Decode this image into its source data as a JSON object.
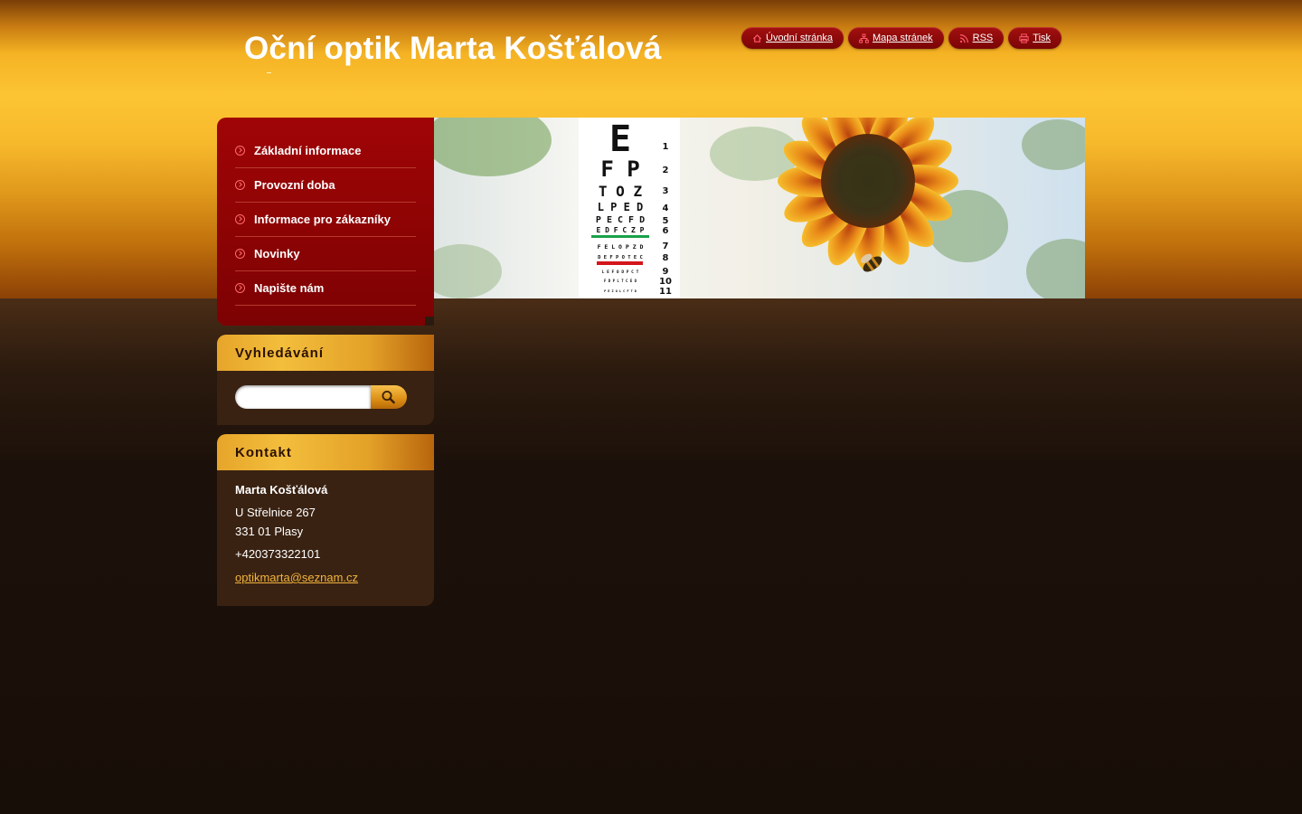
{
  "header": {
    "site_title": "Oční optik Marta Košťálová"
  },
  "top_links": [
    {
      "label": "Úvodní stránka",
      "icon": "home-icon"
    },
    {
      "label": "Mapa stránek",
      "icon": "sitemap-icon"
    },
    {
      "label": "RSS",
      "icon": "rss-icon"
    },
    {
      "label": "Tisk",
      "icon": "print-icon"
    }
  ],
  "nav": {
    "items": [
      {
        "label": "Základní informace"
      },
      {
        "label": "Provozní doba"
      },
      {
        "label": "Informace pro zákazníky"
      },
      {
        "label": "Novinky"
      },
      {
        "label": "Napište nám"
      }
    ]
  },
  "banner": {
    "chart_letters": [
      "E",
      "F P",
      "T O Z",
      "L P E D",
      "P E C F D",
      "E D F C Z P",
      "F E L O P Z D",
      "D E F P O T E C",
      "L E F O D P C T",
      "F D P L T C E O",
      "P E Z O L C F T D"
    ],
    "chart_numbers": [
      "1",
      "2",
      "3",
      "4",
      "5",
      "6",
      "7",
      "8",
      "9",
      "10",
      "11"
    ]
  },
  "search": {
    "heading": "Vyhledávání",
    "placeholder": ""
  },
  "contact": {
    "heading": "Kontakt",
    "name": "Marta Košťálová",
    "street": "U Střelnice 267",
    "city": "331 01 Plasy",
    "phone": "+420373322101",
    "email": "optikmarta@seznam.cz"
  },
  "colors": {
    "nav_red": "#8b0304",
    "accent_gold": "#f3be3c",
    "link_gold": "#f1b43c",
    "dark_bg": "#1a0f08"
  }
}
